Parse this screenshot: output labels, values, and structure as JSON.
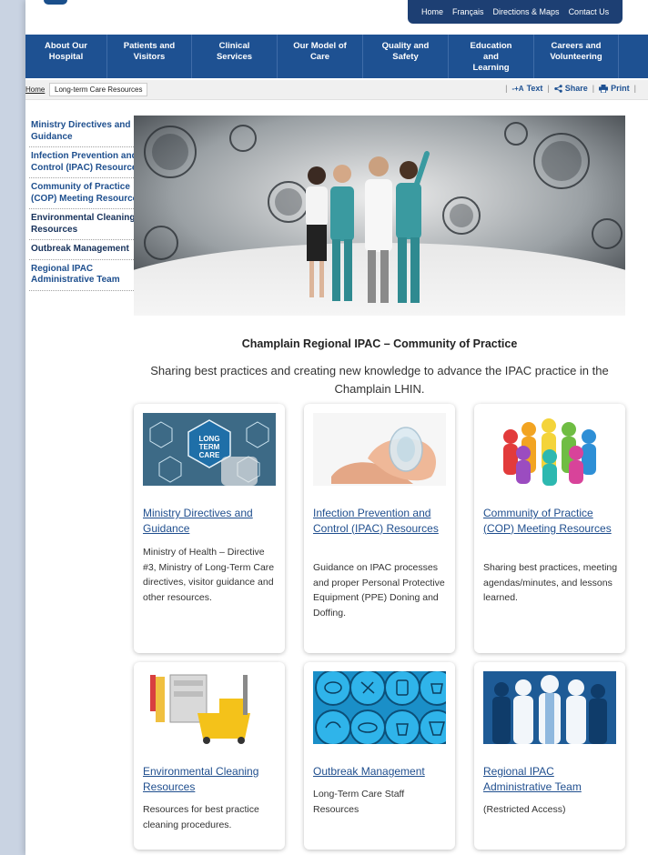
{
  "utility_nav": [
    "Home",
    "Français",
    "Directions & Maps",
    "Contact Us"
  ],
  "main_nav": [
    {
      "label": "About Our Hospital"
    },
    {
      "label": "Patients and Visitors"
    },
    {
      "label": "Clinical Services"
    },
    {
      "label": "Our Model of Care"
    },
    {
      "label": "Quality and Safety"
    },
    {
      "label": "Education and Learning"
    },
    {
      "label": "Careers and Volunteering"
    }
  ],
  "breadcrumb": {
    "home": "Home",
    "current": "Long-term Care Resources"
  },
  "tools": {
    "text": "Text",
    "share": "Share",
    "print": "Print"
  },
  "sidebar": [
    {
      "label": "Ministry Directives and Guidance"
    },
    {
      "label": "Infection Prevention and Control (IPAC) Resources"
    },
    {
      "label": "Community of Practice (COP) Meeting Resources"
    },
    {
      "label": "Environmental Cleaning Resources"
    },
    {
      "label": "Outbreak Management"
    },
    {
      "label": "Regional IPAC Administrative Team"
    }
  ],
  "page": {
    "heading": "Champlain Regional IPAC – Community of Practice",
    "subheading": "Sharing best practices and creating new knowledge to advance the IPAC practice in the Champlain LHIN."
  },
  "cards": [
    {
      "title": "Ministry Directives and Guidance",
      "desc": "Ministry of Health – Directive #3, Ministry of Long-Term Care directives, visitor guidance and other resources.",
      "thumb_text": "LONG TERM CARE"
    },
    {
      "title": "Infection Prevention and Control (IPAC) Resources",
      "desc": "Guidance on IPAC processes and proper Personal Protective Equipment (PPE) Doning and Doffing."
    },
    {
      "title": "Community of Practice (COP) Meeting Resources",
      "desc": "Sharing best practices, meeting agendas/minutes, and lessons learned."
    },
    {
      "title": "Environmental Cleaning Resources",
      "desc": "Resources for best practice cleaning procedures."
    },
    {
      "title": "Outbreak Management",
      "desc": "Long-Term Care Staff Resources"
    },
    {
      "title": "Regional IPAC Administrative Team",
      "desc": "(Restricted Access)"
    }
  ],
  "colors": {
    "nav": "#1e5192",
    "utility": "#1d3f73",
    "link": "#1f4e8e"
  }
}
